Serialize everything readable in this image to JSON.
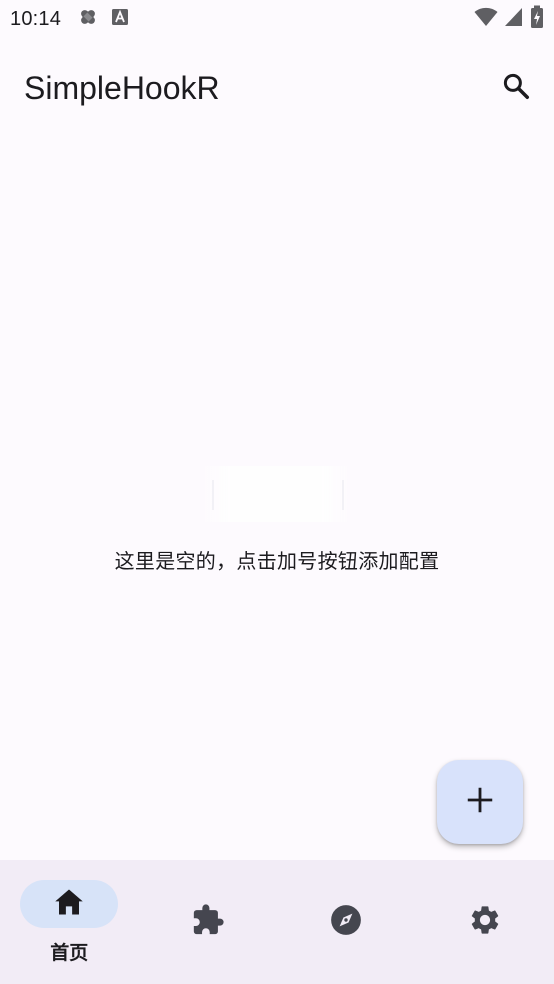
{
  "status_bar": {
    "time": "10:14",
    "left_icons": [
      "bandage-icon",
      "text-a-icon"
    ],
    "right_icons": [
      "wifi-icon",
      "signal-icon",
      "battery-icon"
    ]
  },
  "app_bar": {
    "title": "SimpleHookR",
    "search_icon": "search-icon"
  },
  "empty_state": {
    "message": "这里是空的，点击加号按钮添加配置"
  },
  "fab": {
    "icon": "plus-icon"
  },
  "bottom_nav": {
    "items": [
      {
        "icon": "home-icon",
        "label": "首页",
        "active": true
      },
      {
        "icon": "puzzle-icon",
        "label": "",
        "active": false
      },
      {
        "icon": "compass-icon",
        "label": "",
        "active": false
      },
      {
        "icon": "gear-icon",
        "label": "",
        "active": false
      }
    ]
  },
  "colors": {
    "background": "#fdfafe",
    "nav_background": "#f2ecf6",
    "active_indicator": "#d7e3f8",
    "fab_background": "#d8e2fb",
    "icon_dark": "#1c1b1f"
  }
}
